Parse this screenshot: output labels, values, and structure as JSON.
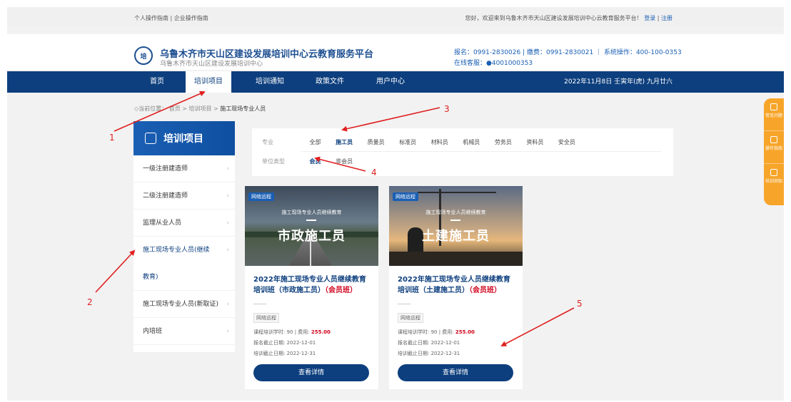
{
  "topbar": {
    "left_text": "个人操作指南 | 企业操作指南",
    "welcome": "您好，欢迎来到乌鲁木齐市天山区建设发展培训中心云教育服务平台！",
    "login": "登录",
    "sep": "|",
    "register": "注册"
  },
  "header": {
    "logo_text": "培",
    "title": "乌鲁木齐市天山区建设发展培训中心云教育服务平台",
    "subtitle": "乌鲁木齐市天山区建设发展培训中心",
    "contact_line1": "报名：0991-2830026 | 缴费：0991-2830021 ｜ 系统操作：400-100-0353",
    "contact_line2": "在线客服：●4001000353"
  },
  "nav": {
    "items": [
      "首页",
      "培训项目",
      "培训通知",
      "政策文件",
      "用户中心"
    ],
    "date": "2022年11月8日 壬寅年(虎) 九月廿六"
  },
  "breadcrumb": {
    "prefix": "◇当前位置：",
    "home": "首页",
    "level2": "培训项目",
    "current": "施工现场专业人员",
    "arrow": ">"
  },
  "sidebar": {
    "title": "培训项目",
    "items": [
      "一级注册建造师",
      "二级注册建造师",
      "监理从业人员",
      "施工现场专业人员(继续教育)",
      "施工现场专业人员(新取证)",
      "内培班"
    ]
  },
  "filter": {
    "major_label": "专业",
    "majors": [
      "全部",
      "施工员",
      "质量员",
      "标准员",
      "材料员",
      "机械员",
      "劳务员",
      "资料员",
      "安全员"
    ],
    "unit_label": "单位类型",
    "units": [
      "会员",
      "非会员"
    ]
  },
  "cards": [
    {
      "tag": "网络远程",
      "img_small": "施工现场专业人员继续教育",
      "img_big": "市政施工员",
      "title_main": "2022年施工现场专业人员继续教育培训班（市政施工员）",
      "title_red": "（会员班）",
      "badge": "网络远程",
      "hours": "课程培训学时: 90 | 费用: ",
      "fee": "255.00",
      "reg_deadline": "报名截止日期: 2022-12-01",
      "train_deadline": "培训截止日期: 2022-12-31",
      "button": "查看详情"
    },
    {
      "tag": "网络远程",
      "img_small": "施工现场专业人员继续教育",
      "img_big": "土建施工员",
      "title_main": "2022年施工现场专业人员继续教育培训班（土建施工员）",
      "title_red": "（会员班）",
      "badge": "网络远程",
      "hours": "课程培训学时: 90 | 费用: ",
      "fee": "255.00",
      "reg_deadline": "报名截止日期: 2022-12-01",
      "train_deadline": "培训截止日期: 2022-12-31",
      "button": "查看详情"
    }
  ],
  "float_bar": {
    "items": [
      "常见问题",
      "操作指南",
      "培训须知"
    ]
  },
  "annotations": {
    "labels": [
      "1",
      "2",
      "3",
      "4",
      "5"
    ],
    "color": "#e02020"
  },
  "colors": {
    "navy": "#0d3f7e",
    "accent_orange": "#f7a52a",
    "fee_red": "#d0021b"
  }
}
